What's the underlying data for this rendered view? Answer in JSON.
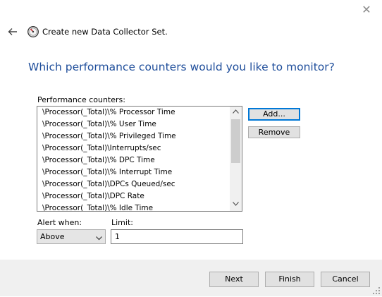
{
  "window": {
    "close_glyph": "✕"
  },
  "header": {
    "title": "Create new Data Collector Set.",
    "back_icon": "back-arrow-icon",
    "app_icon": "performance-gauge-icon"
  },
  "heading": "Which performance counters would you like to monitor?",
  "counters": {
    "label": "Performance counters:",
    "items": [
      "\\Processor(_Total)\\% Processor Time",
      "\\Processor(_Total)\\% User Time",
      "\\Processor(_Total)\\% Privileged Time",
      "\\Processor(_Total)\\Interrupts/sec",
      "\\Processor(_Total)\\% DPC Time",
      "\\Processor(_Total)\\% Interrupt Time",
      "\\Processor(_Total)\\DPCs Queued/sec",
      "\\Processor(_Total)\\DPC Rate",
      "\\Processor(_Total)\\% Idle Time"
    ]
  },
  "side_buttons": {
    "add": "Add...",
    "remove": "Remove"
  },
  "alert": {
    "label": "Alert when:",
    "value": "Above"
  },
  "limit": {
    "label": "Limit:",
    "value": "1"
  },
  "footer": {
    "next": "Next",
    "finish": "Finish",
    "cancel": "Cancel"
  },
  "colors": {
    "heading": "#1f4e9b",
    "default_button_border": "#0078d7"
  }
}
